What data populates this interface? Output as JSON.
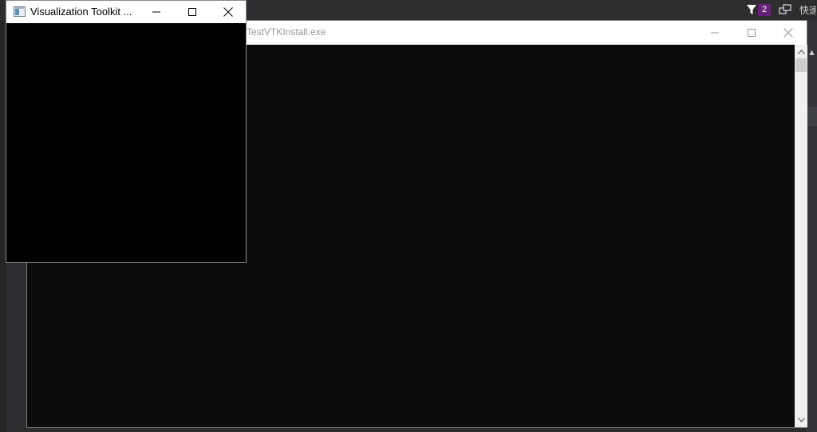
{
  "ide": {
    "notification_count": "2",
    "quick_launch_text": "快速"
  },
  "console_window": {
    "title": "TestVTKInstall.exe",
    "minimize_icon": "minimize-icon",
    "maximize_icon": "maximize-icon",
    "close_icon": "close-icon",
    "background_color": "#0c0c0c"
  },
  "vtk_window": {
    "title": "Visualization Toolkit ...",
    "app_icon": "window-app-icon",
    "minimize_icon": "minimize-icon",
    "maximize_icon": "maximize-icon",
    "close_icon": "close-icon",
    "render_background": "#000000"
  },
  "colors": {
    "ide_background": "#2d2d30",
    "badge": "#68217a",
    "accent": "#007acc"
  }
}
